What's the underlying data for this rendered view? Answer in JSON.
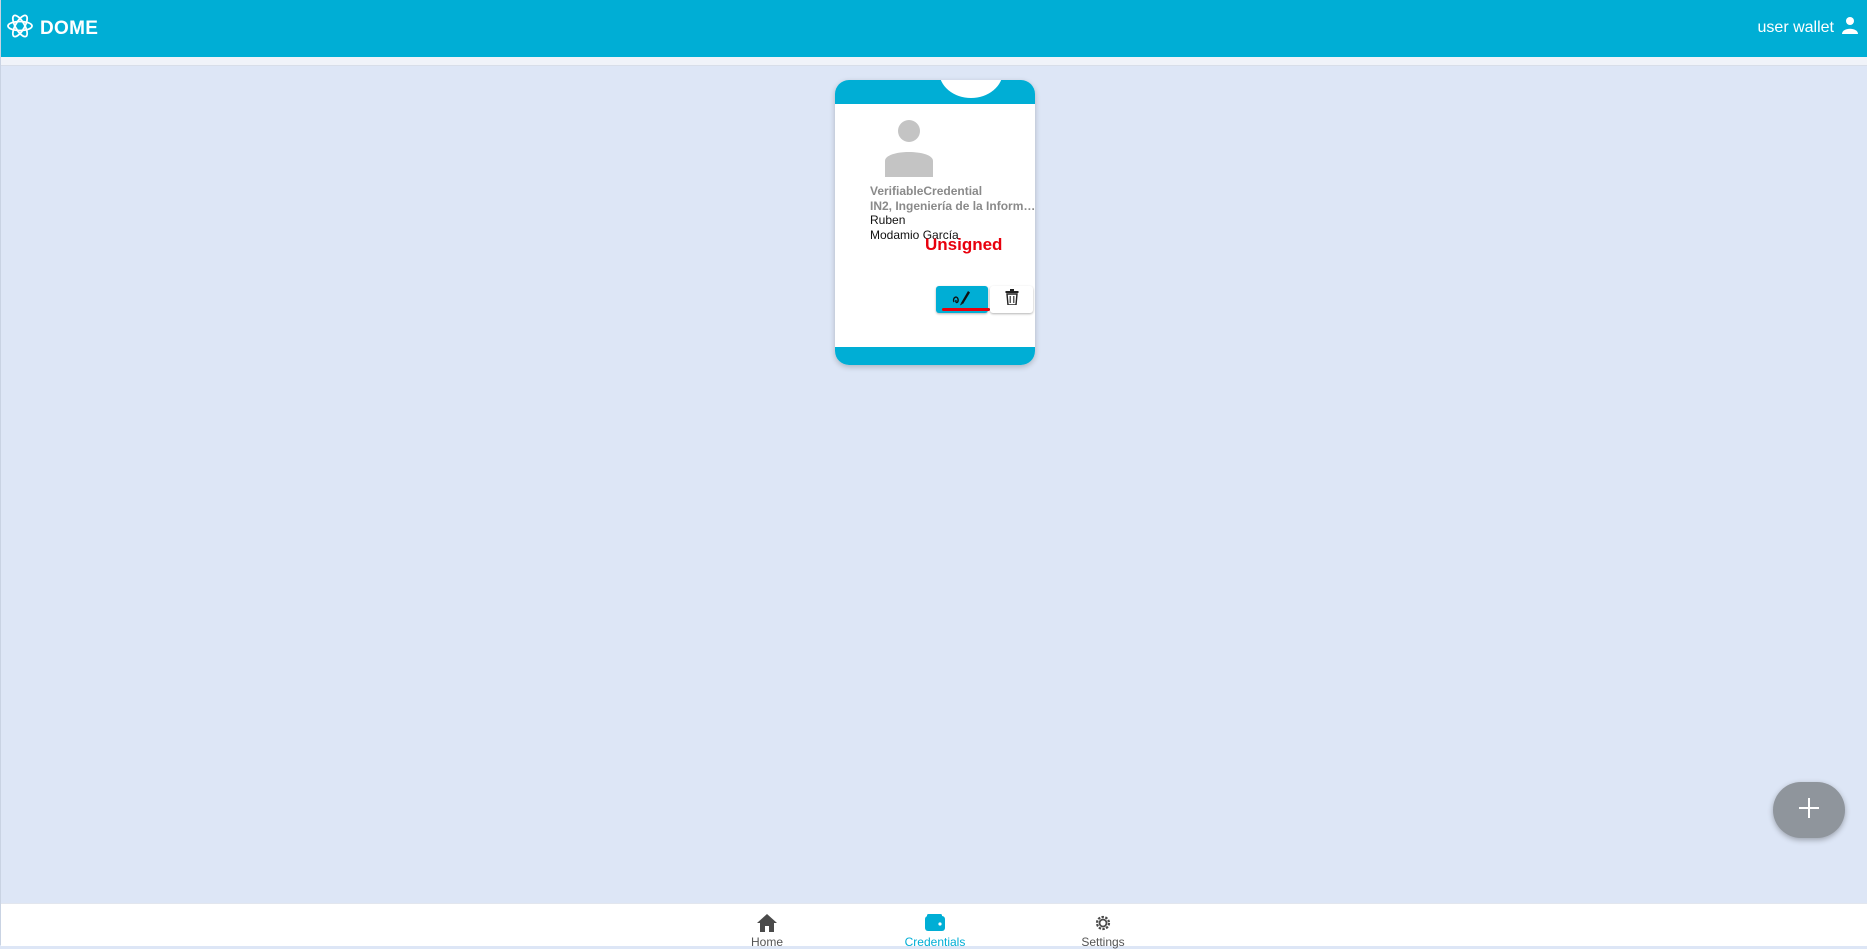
{
  "header": {
    "brand": "DOME",
    "user_label": "user wallet",
    "icons": {
      "logo": "dome-logo-icon",
      "user": "user-icon"
    },
    "colors": {
      "primary": "#00aed5",
      "background": "#dde6f6"
    }
  },
  "credential_card": {
    "type": "VerifiableCredential",
    "issuer": "IN2, Ingeniería de la Informa...",
    "first_name": "Ruben",
    "last_name": "Modamio García",
    "status": "Unsigned",
    "status_color": "#e8000d",
    "actions": {
      "sign_icon": "signature-icon",
      "delete_icon": "trash-icon"
    }
  },
  "fab": {
    "icon": "plus-icon"
  },
  "bottom_nav": {
    "items": [
      {
        "label": "Home",
        "icon": "home-icon",
        "active": false
      },
      {
        "label": "Credentials",
        "icon": "wallet-icon",
        "active": true
      },
      {
        "label": "Settings",
        "icon": "gear-icon",
        "active": false
      }
    ]
  }
}
